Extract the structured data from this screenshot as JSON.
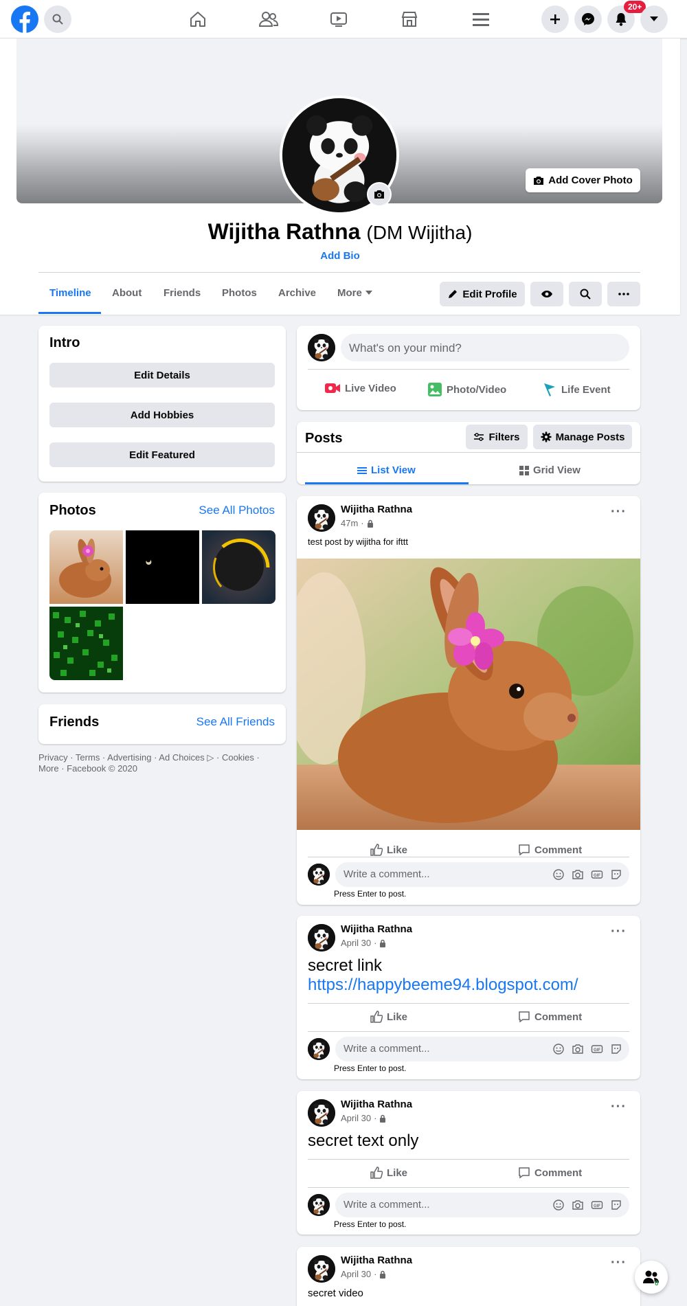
{
  "topnav": {
    "notification_count": "20+",
    "icons": [
      "facebook-logo",
      "search-icon",
      "home-icon",
      "friends-icon",
      "watch-icon",
      "marketplace-icon",
      "menu-icon",
      "create-icon",
      "messenger-icon",
      "notifications-icon",
      "account-dropdown-icon"
    ]
  },
  "profile": {
    "add_cover_label": "Add Cover Photo",
    "name": "Wijitha Rathna",
    "alt_name": "(DM Wijitha)",
    "add_bio": "Add Bio",
    "tabs": [
      "Timeline",
      "About",
      "Friends",
      "Photos",
      "Archive",
      "More"
    ],
    "active_tab": "Timeline",
    "edit_profile_label": "Edit Profile"
  },
  "intro": {
    "title": "Intro",
    "buttons": [
      "Edit Details",
      "Add Hobbies",
      "Edit Featured"
    ]
  },
  "photos": {
    "title": "Photos",
    "see_all": "See All Photos"
  },
  "friends": {
    "title": "Friends",
    "see_all": "See All Friends"
  },
  "footer": {
    "line1": "Privacy · Terms · Advertising · Ad Choices ▷ · Cookies ·",
    "line2": "More · Facebook © 2020"
  },
  "composer": {
    "placeholder": "What's on your mind?",
    "actions": [
      "Live Video",
      "Photo/Video",
      "Life Event"
    ]
  },
  "posts_header": {
    "title": "Posts",
    "filters": "Filters",
    "manage": "Manage Posts",
    "list_view": "List View",
    "grid_view": "Grid View"
  },
  "post_actions": {
    "like": "Like",
    "comment": "Comment",
    "comment_placeholder": "Write a comment...",
    "press_enter": "Press Enter to post."
  },
  "posts": [
    {
      "author": "Wijitha Rathna",
      "time": "47m",
      "text": "test post by wijitha for ifttt"
    },
    {
      "author": "Wijitha Rathna",
      "time": "April 30",
      "text": "secret link",
      "link": "https://happybeeme94.blogspot.com/"
    },
    {
      "author": "Wijitha Rathna",
      "time": "April 30",
      "text": "secret text only"
    },
    {
      "author": "Wijitha Rathna",
      "time": "April 30",
      "text": "secret video"
    }
  ],
  "colors": {
    "brand": "#1877f2",
    "badge": "#e41e3f",
    "background": "#f0f2f5"
  },
  "contacts_badge": "0"
}
